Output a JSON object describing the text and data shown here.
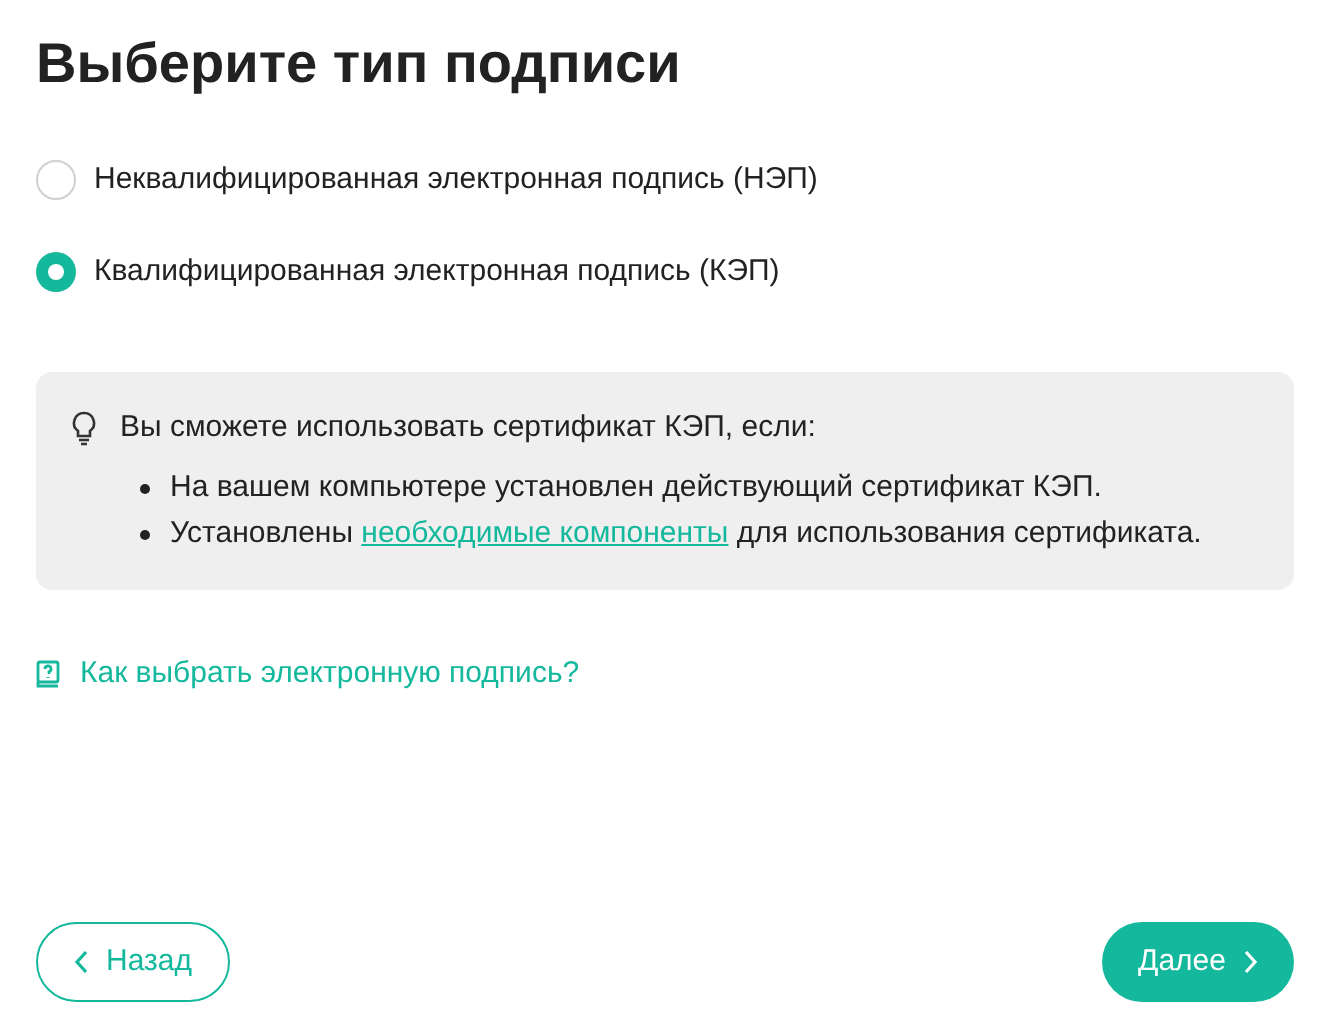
{
  "title": "Выберите тип подписи",
  "options": [
    {
      "label": "Неквалифицированная электронная подпись (НЭП)",
      "selected": false
    },
    {
      "label": "Квалифицированная электронная подпись (КЭП)",
      "selected": true
    }
  ],
  "info": {
    "heading": "Вы сможете использовать сертификат КЭП, если:",
    "items": [
      {
        "before": "На вашем компьютере установлен действующий сертификат КЭП."
      },
      {
        "before": "Установлены ",
        "link": "необходимые компоненты",
        "after": " для использования сертификата."
      }
    ]
  },
  "help_link": "Как выбрать электронную подпись?",
  "buttons": {
    "back": "Назад",
    "next": "Далее"
  }
}
